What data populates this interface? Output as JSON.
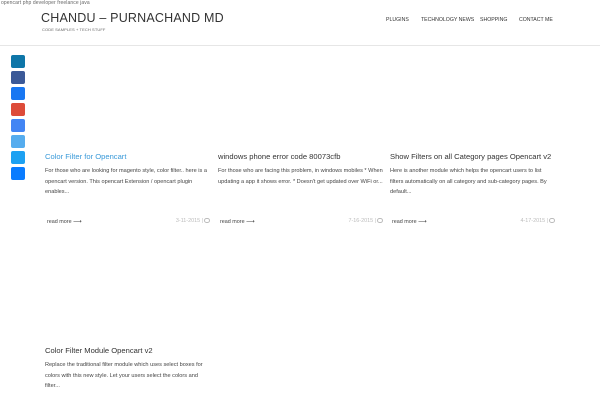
{
  "browser": {
    "url_text": "opencart php developer freelance java"
  },
  "site": {
    "title": "CHANDU – PURNACHAND MD",
    "tagline": "CODE SAMPLES + TECH STUFF"
  },
  "nav": {
    "items": [
      {
        "label": "PLUGINS"
      },
      {
        "label": "TECHNOLOGY NEWS"
      },
      {
        "label": "SHOPPING"
      },
      {
        "label": "CONTACT ME"
      }
    ]
  },
  "share_bar": {
    "buttons": [
      {
        "icon": "linkedin-icon",
        "color": "#0e76a8"
      },
      {
        "icon": "facebook-icon",
        "color": "#3b5998"
      },
      {
        "icon": "share-icon",
        "color": "#1877f2"
      },
      {
        "icon": "google-plus-icon",
        "color": "#dd4b39"
      },
      {
        "icon": "google-icon",
        "color": "#4285f4"
      },
      {
        "icon": "twitter-icon",
        "color": "#55acee"
      },
      {
        "icon": "share-alt-icon",
        "color": "#1da1f2"
      },
      {
        "icon": "messenger-icon",
        "color": "#0a7cff"
      }
    ]
  },
  "posts": [
    {
      "title": "Color Filter for Opencart",
      "excerpt": "For those who are looking for magento style, color filter.. here is a opencart version. This opencart Extension / opencart plugin enables...",
      "read_more": "read more",
      "date": "3-11-2015 |"
    },
    {
      "title": "windows phone error code 80073cfb",
      "excerpt": "For those who are facing this problem, in windows mobiles * When updating a app it shows error. * Doesn't get updated over WiFi or...",
      "read_more": "read more",
      "date": "7-16-2015 |"
    },
    {
      "title": "Show Filters on all Category pages Opencart v2",
      "excerpt": "Here is another module which helps the opencart users to list filters automatically on all category and sub-category pages. By default...",
      "read_more": "read more",
      "date": "4-17-2015 |"
    },
    {
      "title": "Color Filter Module Opencart v2",
      "excerpt": "Replace the traditional filter module which uses select boxes for colors with this new style. Let your users select the colors and filter...",
      "read_more": "",
      "date": ""
    }
  ]
}
